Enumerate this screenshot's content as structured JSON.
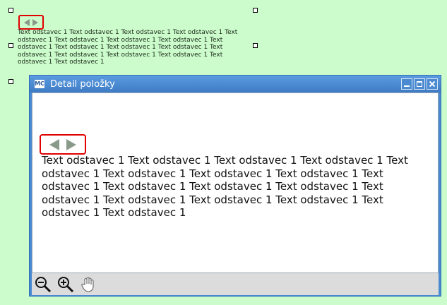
{
  "canvas": {
    "paragraph": "Text odstavec 1 Text odstavec 1 Text odstavec 1 Text odstavec 1 Text odstavec 1 Text odstavec 1 Text odstavec 1 Text odstavec 1 Text odstavec 1 Text odstavec 1 Text odstavec 1 Text odstavec 1 Text odstavec 1 Text odstavec 1 Text odstavec 1 Text odstavec 1 Text odstavec 1 Text odstavec 1"
  },
  "window": {
    "icon_label": "MC",
    "title": "Detail položky",
    "paragraph": "Text odstavec 1 Text odstavec 1 Text odstavec 1 Text odstavec 1 Text odstavec 1 Text odstavec 1 Text odstavec 1 Text odstavec 1 Text odstavec 1 Text odstavec 1 Text odstavec 1 Text odstavec 1 Text odstavec 1 Text odstavec 1 Text odstavec 1 Text odstavec 1 Text odstavec 1 Text odstavec 1"
  },
  "toolbar": {
    "tools": [
      "zoom-out-icon",
      "zoom-in-icon",
      "pan-hand-icon"
    ]
  },
  "colors": {
    "canvas_bg": "#ccfccc",
    "highlight_border": "#e00000",
    "titlebar": "#4a8ad0"
  }
}
